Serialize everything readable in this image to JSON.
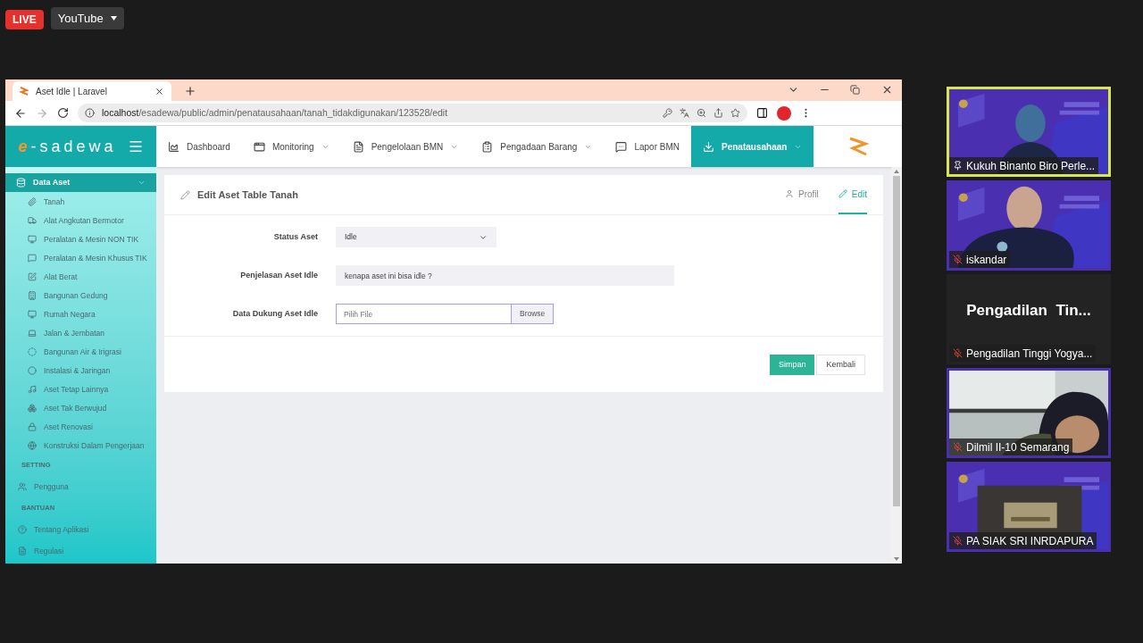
{
  "stream": {
    "live_badge": "LIVE",
    "platform": "YouTube"
  },
  "browser": {
    "tab_title": "Aset Idle | Laravel",
    "url_host": "localhost",
    "url_path": "/esadewa/public/admin/penatausahaan/tanah_tidakdigunakan/123528/edit"
  },
  "app": {
    "logo_mark": "e",
    "logo_text": "-sadewa",
    "nav": [
      {
        "label": "Dashboard",
        "dropdown": false,
        "selected": false
      },
      {
        "label": "Monitoring",
        "dropdown": true,
        "selected": false
      },
      {
        "label": "Pengelolaan BMN",
        "dropdown": true,
        "selected": false
      },
      {
        "label": "Pengadaan Barang",
        "dropdown": true,
        "selected": false
      },
      {
        "label": "Lapor BMN",
        "dropdown": false,
        "selected": false
      },
      {
        "label": "Penatausahaan",
        "dropdown": true,
        "selected": true
      }
    ],
    "sidebar": {
      "group": {
        "label": "Data Aset",
        "expanded": true,
        "items": [
          "Tanah",
          "Alat Angkutan Bermotor",
          "Peralatan & Mesin NON TIK",
          "Peralatan & Mesin Khusus TIK",
          "Alat Berat",
          "Bangunan Gedung",
          "Rumah Negara",
          "Jalan & Jembatan",
          "Bangunan Air & Irigrasi",
          "Instalasi & Jaringan",
          "Aset Tetap Lainnya",
          "Aset Tak Berwujud",
          "Aset Renovasi",
          "Konstruksi Dalam Pengerjaan"
        ]
      },
      "sections": [
        {
          "heading": "SETTING",
          "items": [
            "Pengguna"
          ]
        },
        {
          "heading": "BANTUAN",
          "items": [
            "Tentang Aplikasi",
            "Regulasi"
          ]
        }
      ]
    },
    "form": {
      "title": "Edit Aset Table Tanah",
      "tabs": [
        {
          "label": "Profil",
          "selected": false
        },
        {
          "label": "Edit",
          "selected": true
        }
      ],
      "fields": [
        {
          "kind": "select",
          "label": "Status Aset",
          "value": "Idle"
        },
        {
          "kind": "text",
          "label": "Penjelasan Aset Idle",
          "value": "kenapa aset ini bisa idle ?"
        },
        {
          "kind": "file",
          "label": "Data Dukung Aset Idle",
          "placeholder": "Pilih File",
          "button": "Browse"
        }
      ],
      "buttons": [
        {
          "label": "Simpan",
          "kind": "primary"
        },
        {
          "label": "Kembali",
          "kind": "secondary"
        }
      ]
    }
  },
  "participants": [
    {
      "name": "Kukuh Binanto Biro Perle...",
      "kind": "video",
      "highlighted": true,
      "pinned": true,
      "muted": false
    },
    {
      "name": "iskandar",
      "kind": "video",
      "highlighted": false,
      "pinned": false,
      "muted": true
    },
    {
      "name": "Pengadilan Tinggi Yogya...",
      "kind": "name_only",
      "display": "Pengadilan  Tin...",
      "highlighted": false,
      "pinned": false,
      "muted": true
    },
    {
      "name": "Dilmil II-10 Semarang",
      "kind": "video",
      "highlighted": false,
      "pinned": false,
      "muted": true
    },
    {
      "name": "PA SIAK SRI INRDAPURA",
      "kind": "video",
      "highlighted": false,
      "pinned": false,
      "muted": true
    }
  ]
}
